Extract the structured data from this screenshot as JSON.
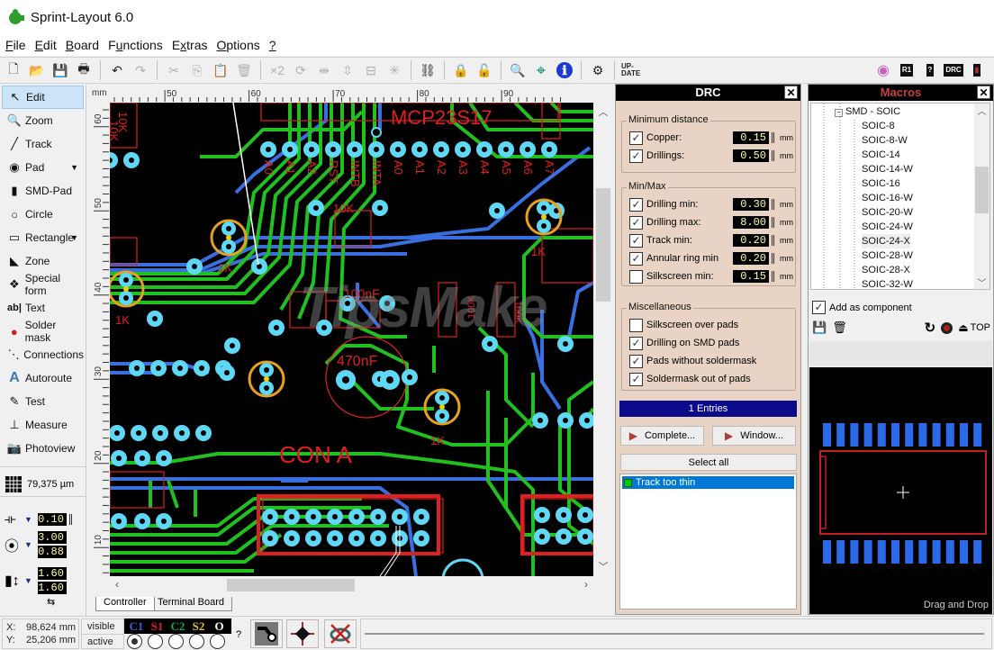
{
  "app": {
    "title": "Sprint-Layout 6.0",
    "logo_color": "#2e9e2e"
  },
  "menu": [
    {
      "label": "File",
      "u": "F",
      "rest": "ile"
    },
    {
      "label": "Edit",
      "u": "E",
      "rest": "dit"
    },
    {
      "label": "Board",
      "u": "B",
      "rest": "oard"
    },
    {
      "label": "Functions",
      "pre": "F",
      "u": "u",
      "rest": "nctions"
    },
    {
      "label": "Extras",
      "pre": "E",
      "u": "x",
      "rest": "tras"
    },
    {
      "label": "Options",
      "u": "O",
      "rest": "ptions"
    },
    {
      "label": "?",
      "u": "?",
      "rest": ""
    }
  ],
  "toolbar": {
    "left": [
      {
        "icon": "new-file-icon",
        "glyph": "🗋"
      },
      {
        "icon": "open-folder-icon",
        "glyph": "📂"
      },
      {
        "icon": "save-icon",
        "glyph": "💾"
      },
      {
        "icon": "print-icon",
        "glyph": "🖶"
      },
      {
        "sep": true
      },
      {
        "icon": "undo-icon",
        "glyph": "↶"
      },
      {
        "icon": "redo-icon",
        "glyph": "↷",
        "disabled": true
      },
      {
        "sep": true
      },
      {
        "icon": "cut-icon",
        "glyph": "✂",
        "disabled": true
      },
      {
        "icon": "copy-icon",
        "glyph": "⎘",
        "disabled": true
      },
      {
        "icon": "paste-icon",
        "glyph": "📋",
        "disabled": true
      },
      {
        "icon": "delete-icon",
        "glyph": "🗑",
        "disabled": true
      },
      {
        "sep": true
      },
      {
        "icon": "duplicate-x2-icon",
        "glyph": "×2",
        "disabled": true
      },
      {
        "icon": "rotate-icon",
        "glyph": "⟳",
        "disabled": true
      },
      {
        "icon": "mirror-horizontal-icon",
        "glyph": "⇹",
        "disabled": true
      },
      {
        "icon": "mirror-vertical-icon",
        "glyph": "⇳",
        "disabled": true
      },
      {
        "icon": "align-icon",
        "glyph": "⊟",
        "disabled": true
      },
      {
        "icon": "explode-icon",
        "glyph": "✳",
        "disabled": true
      },
      {
        "sep": true
      },
      {
        "icon": "connections-icon",
        "glyph": "⛓"
      },
      {
        "sep": true
      },
      {
        "icon": "lock-icon",
        "glyph": "🔒",
        "disabled": true
      },
      {
        "icon": "unlock-icon",
        "glyph": "🔓",
        "disabled": true
      },
      {
        "sep": true
      },
      {
        "icon": "zoom-icon",
        "glyph": "🔍"
      },
      {
        "icon": "snap-icon",
        "glyph": "⌖"
      },
      {
        "icon": "info-icon",
        "glyph": "ℹ"
      },
      {
        "sep": true
      },
      {
        "icon": "photoview-icon",
        "glyph": "⚙"
      },
      {
        "sep": true
      },
      {
        "icon": "update-icon",
        "glyph": "UP-DATE"
      }
    ],
    "right": [
      {
        "icon": "pad-highlight-icon",
        "glyph": "◉"
      },
      {
        "icon": "r1-icon",
        "glyph": "R1"
      },
      {
        "icon": "help-question-icon",
        "glyph": "?"
      },
      {
        "icon": "drc-icon",
        "glyph": "DRC"
      },
      {
        "icon": "macro-panel-icon",
        "glyph": "▮"
      }
    ]
  },
  "tools": [
    {
      "label": "Edit",
      "icon": "arrow-cursor-icon",
      "glyph": "↖",
      "active": true
    },
    {
      "label": "Zoom",
      "icon": "magnifier-icon",
      "glyph": "🔍"
    },
    {
      "label": "Track",
      "icon": "track-icon",
      "glyph": "╱"
    },
    {
      "label": "Pad",
      "icon": "pad-icon",
      "glyph": "◉",
      "dropdown": true
    },
    {
      "label": "SMD-Pad",
      "icon": "smd-pad-icon",
      "glyph": "▮"
    },
    {
      "label": "Circle",
      "icon": "circle-icon",
      "glyph": "○"
    },
    {
      "label": "Rectangle",
      "icon": "rectangle-icon",
      "glyph": "▭",
      "dropdown": true
    },
    {
      "label": "Zone",
      "icon": "zone-icon",
      "glyph": "◣"
    },
    {
      "label": "Special form",
      "icon": "special-form-icon",
      "glyph": "❖"
    },
    {
      "label": "Text",
      "icon": "text-icon",
      "glyph": "ab|"
    },
    {
      "label": "Solder mask",
      "icon": "solder-mask-icon",
      "glyph": "●"
    },
    {
      "label": "Connections",
      "icon": "connections-icon",
      "glyph": "⋱"
    },
    {
      "label": "Autoroute",
      "icon": "autoroute-icon",
      "glyph": "A"
    },
    {
      "label": "Test",
      "icon": "test-probe-icon",
      "glyph": "✎"
    },
    {
      "label": "Measure",
      "icon": "measure-ruler-icon",
      "glyph": "⊥"
    },
    {
      "label": "Photoview",
      "icon": "camera-icon",
      "glyph": "📷"
    }
  ],
  "grid": {
    "value": "79,375 µm"
  },
  "track_width": "0.10",
  "pad_outer": "3.00",
  "pad_inner": "0.88",
  "smd_width": "1.60",
  "smd_height": "1.60",
  "ruler": {
    "unit": "mm",
    "x_ticks": [
      "50",
      "60",
      "70",
      "80",
      "90"
    ],
    "y_ticks": [
      "60",
      "50",
      "40",
      "30",
      "20",
      "10"
    ]
  },
  "board_tabs": [
    "Controller",
    "Terminal Board"
  ],
  "pcb": {
    "labels": [
      "MCP23S17",
      "10K",
      "10K",
      "10K",
      "1K",
      "1K",
      "1K",
      "1K",
      "1K",
      "100nF",
      "470nF",
      "100K",
      "100K",
      "CON A"
    ],
    "pin_labels": [
      "A0",
      "A1",
      "A2",
      "RST",
      "INTB",
      "INTA",
      "A0",
      "A1",
      "A2",
      "A3",
      "A4",
      "A5",
      "A6",
      "A7"
    ],
    "colors": {
      "copper_top": "#20c020",
      "copper_bottom": "#3a6fe0",
      "silk": "#e02020",
      "pad": "#5fd8f5",
      "via_ring": "#e8a020"
    }
  },
  "watermark": "TipsMake",
  "drc": {
    "title": "DRC",
    "min_distance": {
      "title": "Minimum distance",
      "rows": [
        {
          "label": "Copper:",
          "checked": true,
          "value": "0.15",
          "unit": "mm"
        },
        {
          "label": "Drillings:",
          "checked": true,
          "value": "0.50",
          "unit": "mm"
        }
      ]
    },
    "minmax": {
      "title": "Min/Max",
      "rows": [
        {
          "label": "Drilling min:",
          "checked": true,
          "value": "0.30",
          "unit": "mm"
        },
        {
          "label": "Drilling max:",
          "checked": true,
          "value": "8.00",
          "unit": "mm"
        },
        {
          "label": "Track min:",
          "checked": true,
          "value": "0.20",
          "unit": "mm"
        },
        {
          "label": "Annular ring min",
          "checked": true,
          "value": "0.20",
          "unit": "mm"
        },
        {
          "label": "Silkscreen min:",
          "checked": false,
          "value": "0.15",
          "unit": "mm"
        }
      ]
    },
    "misc": {
      "title": "Miscellaneous",
      "rows": [
        {
          "label": "Silkscreen over pads",
          "checked": false
        },
        {
          "label": "Drilling on SMD pads",
          "checked": true
        },
        {
          "label": "Pads without soldermask",
          "checked": true
        },
        {
          "label": "Soldermask out of pads",
          "checked": true
        }
      ]
    },
    "entries": "1 Entries",
    "complete_label": "Complete...",
    "window_label": "Window...",
    "select_all_label": "Select all",
    "errors": [
      "Track too thin"
    ]
  },
  "macros": {
    "title": "Macros",
    "group": "SMD - SOIC",
    "items": [
      "SOIC-8",
      "SOIC-8-W",
      "SOIC-14",
      "SOIC-14-W",
      "SOIC-16",
      "SOIC-16-W",
      "SOIC-20-W",
      "SOIC-24-W",
      "SOIC-24-X",
      "SOIC-28-W",
      "SOIC-28-X",
      "SOIC-32-W"
    ],
    "add_as_component": {
      "label": "Add as component",
      "checked": true
    },
    "top_label": "TOP",
    "drag_drop": "Drag and Drop",
    "preview_pins_per_side": 12
  },
  "status": {
    "x_label": "X:",
    "x_value": "98,624 mm",
    "y_label": "Y:",
    "y_value": "25,206 mm",
    "visible_label": "visible",
    "active_label": "active",
    "layers": [
      {
        "name": "C1",
        "color": "#3a5fd0"
      },
      {
        "name": "S1",
        "color": "#d02020"
      },
      {
        "name": "C2",
        "color": "#20a040"
      },
      {
        "name": "S2",
        "color": "#d8c040"
      },
      {
        "name": "O",
        "color": "#ffffff"
      }
    ],
    "active_layer_index": 0,
    "help": "?"
  }
}
